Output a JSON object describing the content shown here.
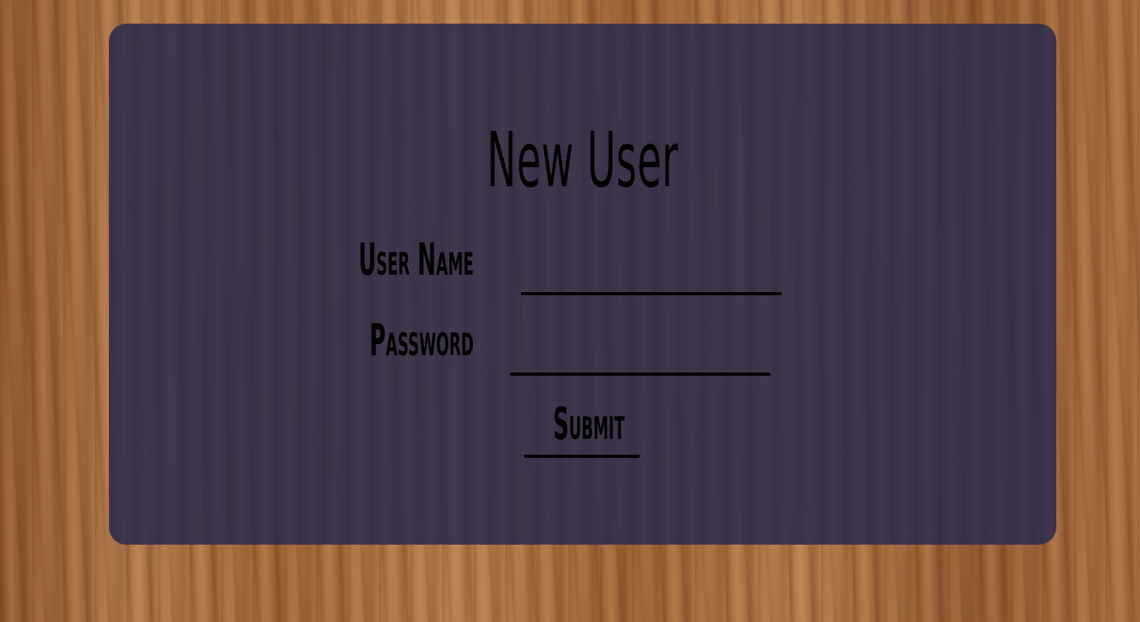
{
  "form": {
    "title": "New User",
    "username_label": "User Name",
    "username_value": "",
    "password_label": "Password",
    "password_value": "",
    "submit_label": "Submit"
  }
}
